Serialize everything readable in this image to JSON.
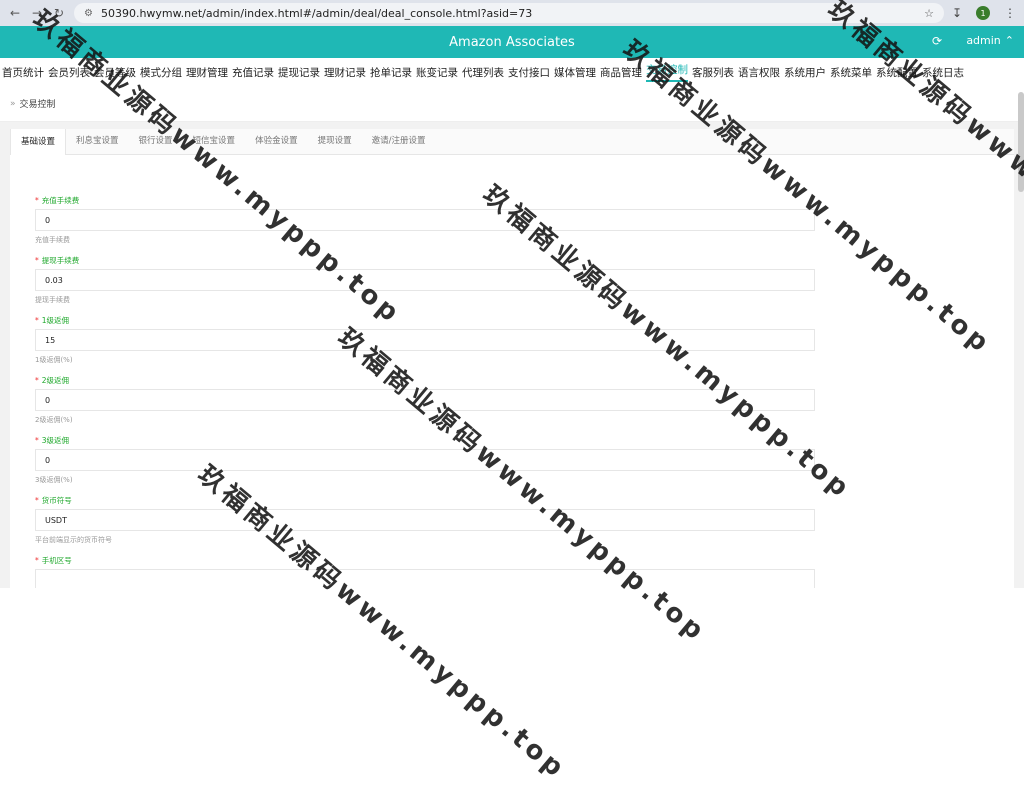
{
  "browser": {
    "url": "50390.hwymw.net/admin/index.html#/admin/deal/deal_console.html?asid=73",
    "profile_initial": "1"
  },
  "app": {
    "title": "Amazon Associates",
    "user": "admin"
  },
  "menu": {
    "items": [
      "首页统计",
      "会员列表",
      "会员等级",
      "模式分组",
      "理财管理",
      "充值记录",
      "提现记录",
      "理财记录",
      "抢单记录",
      "账变记录",
      "代理列表",
      "支付接口",
      "媒体管理",
      "商品管理",
      "交易控制",
      "客服列表",
      "语言权限",
      "系统用户",
      "系统菜单",
      "系统配置",
      "系统日志"
    ],
    "active_index": 14
  },
  "breadcrumb": {
    "label": "交易控制"
  },
  "tabs": [
    "基础设置",
    "利息宝设置",
    "银行设置",
    "短信宝设置",
    "体验金设置",
    "提现设置",
    "邀请/注册设置"
  ],
  "active_tab": 0,
  "fields": [
    {
      "label": "充值手续费",
      "value": "0",
      "help": "充值手续费"
    },
    {
      "label": "提现手续费",
      "value": "0.03",
      "help": "提现手续费"
    },
    {
      "label": "1级返佣",
      "value": "15",
      "help": "1级返佣(%)"
    },
    {
      "label": "2级返佣",
      "value": "0",
      "help": "2级返佣(%)"
    },
    {
      "label": "3级返佣",
      "value": "0",
      "help": "3级返佣(%)"
    },
    {
      "label": "货币符号",
      "value": "USDT",
      "help": "平台前端显示的货币符号"
    },
    {
      "label": "手机区号",
      "value": "",
      "help": ""
    }
  ],
  "watermark": "玖福商业源码www.myppp.top"
}
